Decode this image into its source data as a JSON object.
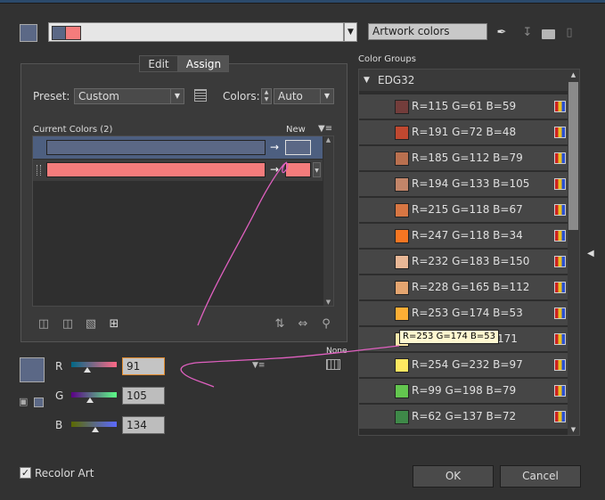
{
  "harmony": {
    "colors": [
      "#5b6886",
      "#f47c7c"
    ]
  },
  "top": {
    "group_name": "Artwork colors",
    "icons": [
      "eyedropper-icon",
      "save-group-icon",
      "new-folder-icon",
      "trash-icon"
    ]
  },
  "tabs": [
    {
      "label": "Edit"
    },
    {
      "label": "Assign"
    }
  ],
  "preset": {
    "label": "Preset:",
    "value": "Custom"
  },
  "colors_field": {
    "label": "Colors:",
    "value": "Auto"
  },
  "current_colors": {
    "header": "Current Colors (2)",
    "new_label": "New",
    "rows": [
      {
        "current": "#5b6886",
        "new": "#5b6886"
      },
      {
        "current": "#f47c7c",
        "new": "#f47c7c"
      }
    ]
  },
  "rgb": {
    "r": {
      "label": "R",
      "value": "91",
      "level": 91
    },
    "g": {
      "label": "G",
      "value": "105",
      "level": 105
    },
    "b": {
      "label": "B",
      "value": "134",
      "level": 134
    }
  },
  "none_label": "None",
  "color_groups": {
    "label": "Color Groups",
    "group_name": "EDG32",
    "swatches": [
      {
        "label": "R=115 G=61 B=59",
        "color": "#733d3b"
      },
      {
        "label": "R=191 G=72 B=48",
        "color": "#bf4830"
      },
      {
        "label": "R=185 G=112 B=79",
        "color": "#b9704f"
      },
      {
        "label": "R=194 G=133 B=105",
        "color": "#c28569"
      },
      {
        "label": "R=215 G=118 B=67",
        "color": "#d77643"
      },
      {
        "label": "R=247 G=118 B=34",
        "color": "#f77622"
      },
      {
        "label": "R=232 G=183 B=150",
        "color": "#e8b796"
      },
      {
        "label": "R=228 G=165 B=112",
        "color": "#e4a570"
      },
      {
        "label": "R=253 G=174 B=53",
        "color": "#fdae35"
      },
      {
        "label": "171",
        "color": "#fde9ab"
      },
      {
        "label": "R=254 G=232 B=97",
        "color": "#fee861"
      },
      {
        "label": "R=99 G=198 B=79",
        "color": "#63c64f"
      },
      {
        "label": "R=62 G=137 B=72",
        "color": "#3e8948"
      }
    ]
  },
  "tooltip": "R=253 G=174 B=53",
  "recolor_art": {
    "label": "Recolor Art",
    "checked": true
  },
  "buttons": {
    "ok": "OK",
    "cancel": "Cancel"
  }
}
